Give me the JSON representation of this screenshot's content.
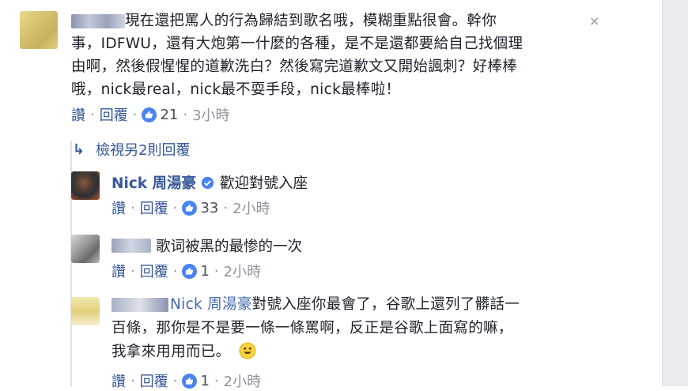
{
  "comments": {
    "c1": {
      "text_lines": [
        "現在還把罵人的行為歸結到歌名哦，模糊重點很會。幹你",
        "事，IDFWU，還有大炮第一什麼的各種，是不是還都要給自己找個理",
        "由啊，然後假惺惺的道歉洗白？然後寫完道歉文又開始諷刺？好棒棒",
        "哦，nick最real，nick最不耍手段，nick最棒啦！"
      ],
      "like_label": "讚",
      "reply_label": "回覆",
      "like_count": "21",
      "time": "3小時"
    },
    "view_more": "檢視另2則回覆",
    "r1": {
      "author": "Nick 周湯豪",
      "text": "歡迎對號入座",
      "like_label": "讚",
      "reply_label": "回覆",
      "like_count": "33",
      "time": "2小時"
    },
    "r2": {
      "text": "歌词被黑的最惨的一次",
      "like_label": "讚",
      "reply_label": "回覆",
      "like_count": "1",
      "time": "2小時"
    },
    "r3": {
      "mention": "Nick 周湯豪",
      "text_line1": "對號入座你最會了，谷歌上還列了髒話一",
      "text_line2": "百條，那你是不是要一條一條罵啊，反正是谷歌上面寫的嘛，",
      "text_line3": "我拿來用用而已。",
      "like_label": "讚",
      "reply_label": "回覆",
      "like_count": "1",
      "time": "2小時"
    }
  },
  "icons": {
    "close": "×",
    "reply_arrow": "↳"
  },
  "colors": {
    "link": "#365899",
    "like_blue": "#4a82f4",
    "muted": "#90949c"
  }
}
